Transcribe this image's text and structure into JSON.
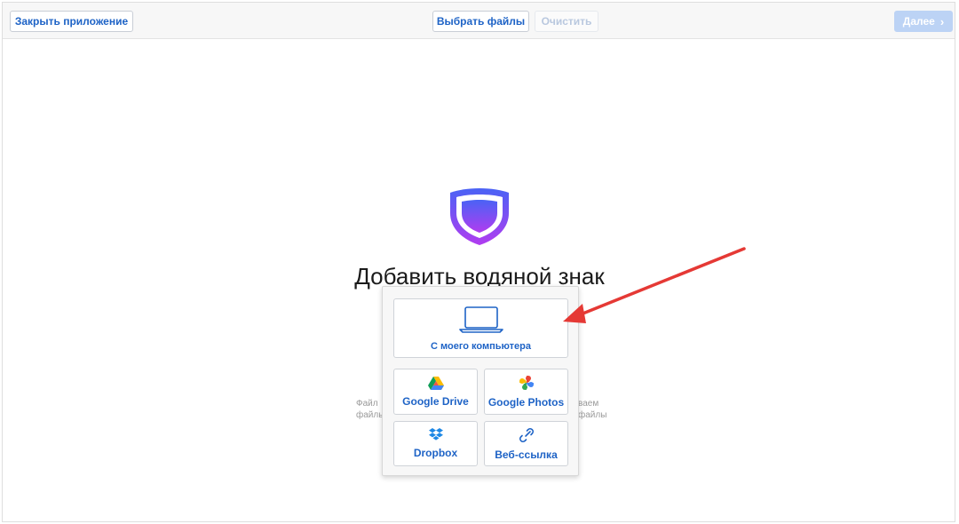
{
  "toolbar": {
    "close_label": "Закрыть приложение",
    "choose_label": "Выбрать файлы",
    "clear_label": "Очистить",
    "next_label": "Далее"
  },
  "main": {
    "title": "Добавить водяной знак",
    "hint_left_line1": "Файл",
    "hint_left_line2": "файлы",
    "hint_right_line1": "ваем",
    "hint_right_line2": "файлы"
  },
  "source_menu": {
    "computer": "С моего компьютера",
    "google_drive": "Google Drive",
    "google_photos": "Google Photos",
    "dropbox": "Dropbox",
    "web_link": "Веб-ссылка"
  },
  "colors": {
    "accent": "#1e63c6",
    "logo_top": "#4a63f5",
    "logo_bottom": "#b13cf0",
    "annotation_arrow": "#e53935"
  }
}
